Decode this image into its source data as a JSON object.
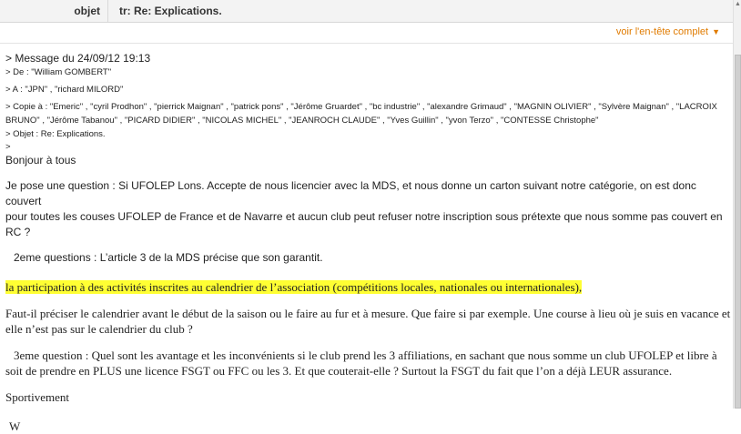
{
  "header": {
    "subject_label": "objet",
    "subject_value": "tr: Re: Explications.",
    "full_header_link": "voir l'en-tête complet"
  },
  "quoted": {
    "title": "> Message du 24/09/12 19:13",
    "from": "> De : \"William GOMBERT\"",
    "to": "> A : \"JPN\" , \"richard MILORD\"",
    "cc_line1": "> Copie à : \"Emeric\" , \"cyril Prodhon\" , \"pierrick Maignan\" , \"patrick pons\" , \"Jérôme Gruardet\" , \"bc industrie\" , \"alexandre Grimaud\" , \"MAGNIN OLIVIER\" , \"Sylvère Maignan\" , \"LACROIX",
    "cc_line2": "BRUNO\" , \"Jérôme Tabanou\" , \"PICARD DIDIER\" , \"NICOLAS MICHEL\" , \"JEANROCH CLAUDE\" , \"Yves Guillin\" , \"yvon Terzo\" , \"CONTESSE Christophe\"",
    "subject": "> Objet : Re: Explications.",
    "sep": ">"
  },
  "message": {
    "greeting": "Bonjour à tous",
    "q1_line1": "Je pose une question : Si UFOLEP Lons. Accepte de nous licencier avec la MDS, et nous  donne un carton suivant notre catégorie, on est donc couvert",
    "q1_line2": "pour toutes les couses UFOLEP de France et de Navarre et aucun club peut refuser notre inscription sous prétexte que nous somme pas couvert en RC ?",
    "q2": "2eme questions : L’article 3 de la MDS précise que son garantit.",
    "highlight": "la participation à des activités inscrites au calendrier de l’association (compétitions locales, nationales ou internationales),",
    "p3_line1": "Faut-il préciser le calendrier avant le début de la saison ou le faire au fur et à mesure. Que faire si par exemple. Une course à lieu où je suis en vacance et",
    "p3_line2": "elle n’est pas sur le calendrier du club ?",
    "q3_line1": "3eme question : Quel sont les avantage et les inconvénients si le club prend les 3 affiliations, en sachant que nous somme un club UFOLEP et libre à",
    "q3_line2": "soit  de prendre en PLUS une licence FSGT ou FFC ou les 3. Et que couterait-elle ? Surtout la FSGT du fait que l’on a déjà LEUR assurance.",
    "closing": "Sportivement",
    "signature": "W"
  },
  "colors": {
    "link": "#e07b00",
    "highlight": "#ffff33"
  },
  "icons": {
    "link_chevron": "chevron-down-icon",
    "scroll_up": "arrow-up-icon"
  }
}
